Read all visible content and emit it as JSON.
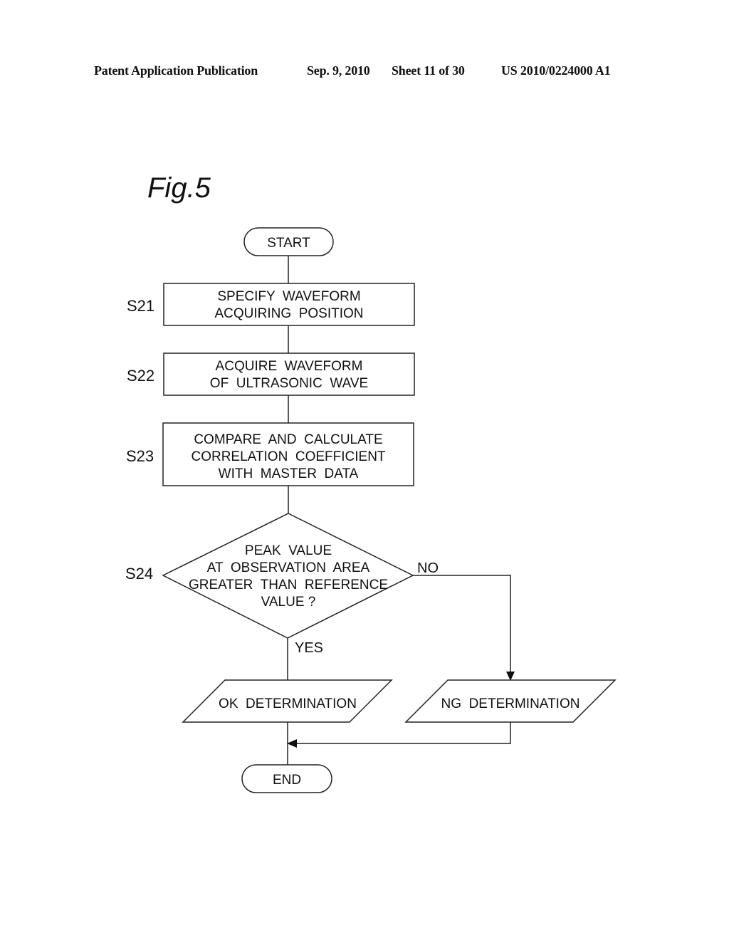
{
  "header": {
    "publication": "Patent Application Publication",
    "date": "Sep. 9, 2010",
    "sheet": "Sheet 11 of 30",
    "number": "US 2010/0224000 A1"
  },
  "figure": {
    "label": "Fig.5"
  },
  "flowchart": {
    "start": "START",
    "end": "END",
    "steps": [
      {
        "id": "S21",
        "lines": [
          "SPECIFY  WAVEFORM",
          "ACQUIRING  POSITION"
        ]
      },
      {
        "id": "S22",
        "lines": [
          "ACQUIRE  WAVEFORM",
          "OF  ULTRASONIC  WAVE"
        ]
      },
      {
        "id": "S23",
        "lines": [
          "COMPARE  AND  CALCULATE",
          "CORRELATION  COEFFICIENT",
          "WITH  MASTER  DATA"
        ]
      }
    ],
    "decision": {
      "id": "S24",
      "lines": [
        "PEAK  VALUE",
        "AT  OBSERVATION  AREA",
        "GREATER  THAN  REFERENCE",
        "VALUE ?"
      ],
      "yes_label": "YES",
      "no_label": "NO"
    },
    "outputs": {
      "ok": "OK  DETERMINATION",
      "ng": "NG  DETERMINATION"
    }
  }
}
